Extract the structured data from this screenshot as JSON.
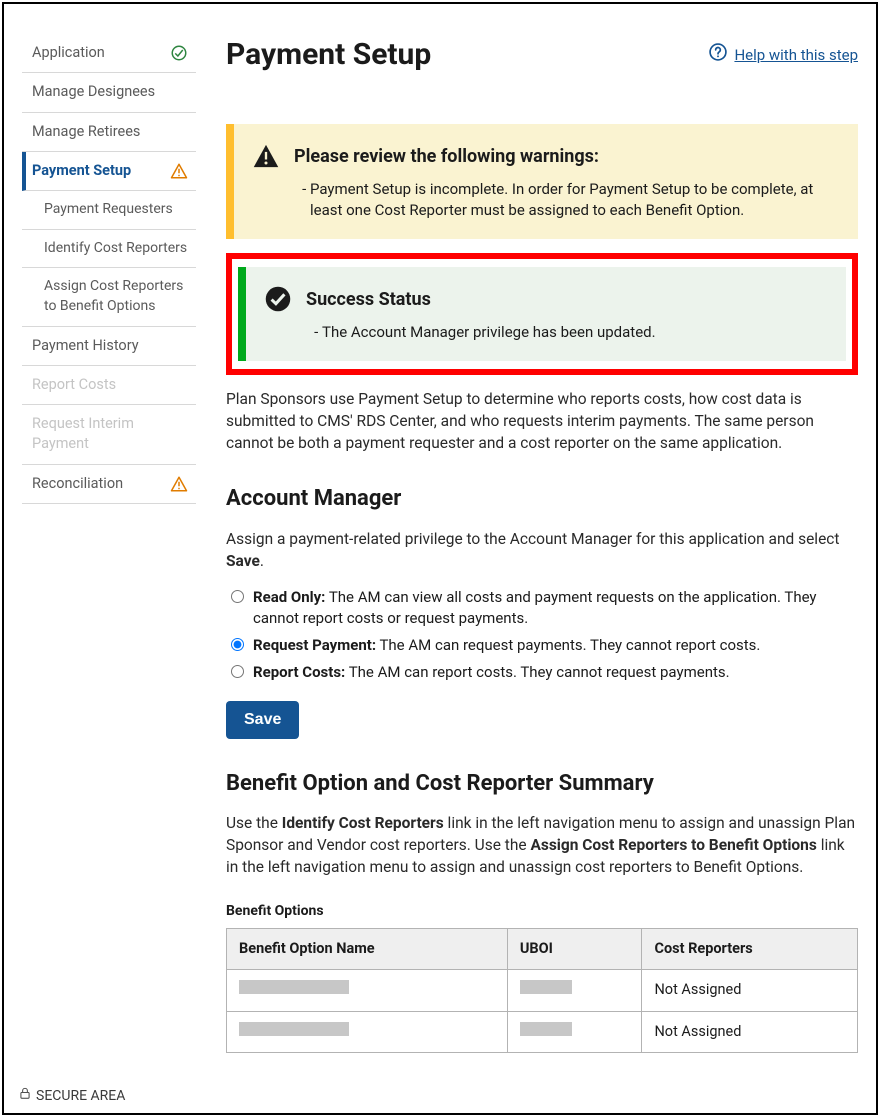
{
  "page": {
    "title": "Payment Setup",
    "help_label": "Help with this step",
    "footer": "SECURE AREA"
  },
  "sidebar": {
    "items": [
      {
        "label": "Application",
        "icon": "check-circle",
        "status": "ok"
      },
      {
        "label": "Manage Designees"
      },
      {
        "label": "Manage Retirees"
      },
      {
        "label": "Payment Setup",
        "active": true,
        "icon": "warn-triangle"
      },
      {
        "label": "Payment Requesters",
        "sub": true
      },
      {
        "label": "Identify Cost Reporters",
        "sub": true
      },
      {
        "label": "Assign Cost Reporters to Benefit Options",
        "sub": true
      },
      {
        "label": "Payment History"
      },
      {
        "label": "Report Costs",
        "disabled": true
      },
      {
        "label": "Request Interim Payment",
        "disabled": true
      },
      {
        "label": "Reconciliation",
        "icon": "warn-triangle"
      }
    ]
  },
  "warning_box": {
    "title": "Please review the following warnings:",
    "items": [
      "Payment Setup is incomplete. In order for Payment Setup to be complete, at least one Cost Reporter must be assigned to each Benefit Option."
    ]
  },
  "success_box": {
    "title": "Success Status",
    "items": [
      "The Account Manager privilege has been updated."
    ]
  },
  "intro_text": "Plan Sponsors use Payment Setup to determine who reports costs, how cost data is submitted to CMS' RDS Center, and who requests interim payments. The same person cannot be both a payment requester and a cost reporter on the same application.",
  "account_manager": {
    "heading": "Account Manager",
    "instruction_pre": "Assign a payment-related privilege to the Account Manager for this application and select ",
    "instruction_bold": "Save",
    "instruction_post": ".",
    "options": [
      {
        "label": "Read Only:",
        "desc": " The AM can view all costs and payment requests on the application. They cannot report costs or request payments.",
        "checked": false
      },
      {
        "label": "Request Payment:",
        "desc": " The AM can request payments. They cannot report costs.",
        "checked": true
      },
      {
        "label": "Report Costs:",
        "desc": " The AM can report costs. They cannot request payments.",
        "checked": false
      }
    ],
    "save_label": "Save"
  },
  "summary": {
    "heading": "Benefit Option and Cost Reporter Summary",
    "text_parts": [
      "Use the ",
      "Identify Cost Reporters",
      " link in the left navigation menu to assign and unassign Plan Sponsor and Vendor cost reporters. Use the ",
      "Assign Cost Reporters to Benefit Options",
      " link in the left navigation menu to assign and unassign cost reporters to Benefit Options."
    ],
    "table_caption": "Benefit Options",
    "columns": [
      "Benefit Option Name",
      "UBOI",
      "Cost Reporters"
    ],
    "rows": [
      {
        "name": "",
        "uboi": "",
        "reporters": "Not Assigned"
      },
      {
        "name": "",
        "uboi": "",
        "reporters": "Not Assigned"
      }
    ]
  }
}
